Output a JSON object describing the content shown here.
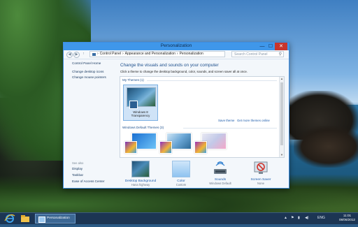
{
  "window": {
    "title": "Personalization",
    "controls": {
      "minimize": "—",
      "maximize": "☐",
      "close": "✕"
    }
  },
  "address": {
    "back": "◀",
    "forward": "▶",
    "up": "↑",
    "path": [
      "Control Panel",
      "Appearance and Personalization",
      "Personalization"
    ],
    "separator": "›",
    "search_placeholder": "Search Control Panel"
  },
  "sidebar": {
    "home": "Control Panel Home",
    "links": [
      "Change desktop icons",
      "Change mouse pointers"
    ],
    "see_also_label": "See also",
    "see_also": [
      "Display",
      "Taskbar",
      "Ease of Access Center"
    ]
  },
  "main": {
    "heading": "Change the visuals and sounds on your computer",
    "subheading": "Click a theme to change the desktop background, color, sounds, and screen saver all at once.",
    "my_themes_label": "My Themes (1)",
    "selected_theme_name": "Windows 8 Transparency",
    "save_theme": "Save theme",
    "more_themes": "Get more themes online",
    "default_themes_label": "Windows Default Themes (3)"
  },
  "bottom": [
    {
      "label": "Desktop Background",
      "value": "Hana highway"
    },
    {
      "label": "Color",
      "value": "Custom"
    },
    {
      "label": "Sounds",
      "value": "Windows Default"
    },
    {
      "label": "Screen Saver",
      "value": "None"
    }
  ],
  "taskbar": {
    "task_label": "Personalization",
    "language": "ENG",
    "time": "11:01",
    "date": "08/06/2012"
  },
  "colors": {
    "titlebar": "#3f97ea",
    "close": "#c7352c",
    "link": "#1d5cab",
    "taskbar": "#1c3553"
  }
}
